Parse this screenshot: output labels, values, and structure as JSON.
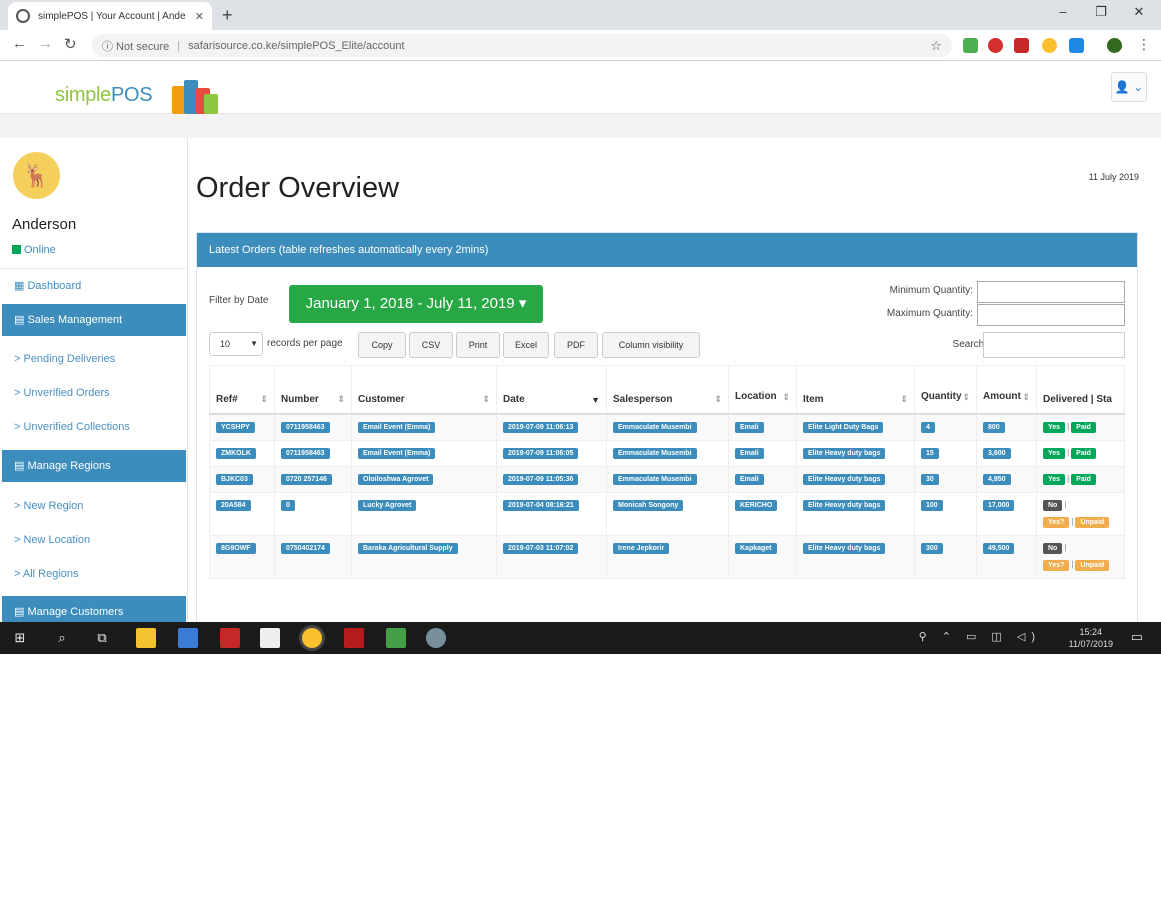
{
  "browser": {
    "tab_title": "simplePOS | Your Account | Ande",
    "tab_close": "✕",
    "new_tab": "+",
    "minimize": "–",
    "restore": "❐",
    "close": "✕",
    "back": "←",
    "forward": "→",
    "reload": "↻",
    "security": "ⓘ Not secure",
    "url": "safarisource.co.ke/simplePOS_Elite/account",
    "bookmark": "☆",
    "menu": "⋮"
  },
  "header": {
    "logo_simple": "simple",
    "logo_pos": "POS",
    "user_menu": "👤 ⌄"
  },
  "sidebar": {
    "avatar": "🦌",
    "user_name": "Anderson",
    "status": "Online",
    "dashboard": "▦ Dashboard",
    "sections": {
      "sales": "▤ Sales Management",
      "regions": "▤ Manage Regions",
      "customers": "▤ Manage Customers"
    },
    "sales_items": [
      "> Pending Deliveries",
      "> Unverified Orders",
      "> Unverified Collections"
    ],
    "region_items": [
      "> New Region",
      "> New Location",
      "> All Regions"
    ]
  },
  "main": {
    "title": "Order Overview",
    "date": "11 July 2019",
    "box_title": "Latest Orders (table refreshes automatically every 2mins)",
    "filter_label": "Filter by Date",
    "date_range": "January 1, 2018 - July 11, 2019 ▾",
    "min_qty_label": "Minimum Quantity:",
    "max_qty_label": "Maximum Quantity:",
    "page_size": "10",
    "per_page": "records per page",
    "buttons": [
      "Copy",
      "CSV",
      "Print",
      "Excel",
      "PDF",
      "Column visibility"
    ],
    "search_label": "Search:"
  },
  "table": {
    "columns": [
      "Ref#",
      "Number",
      "Customer",
      "Date",
      "Salesperson",
      "Location",
      "Item",
      "Quantity",
      "Amount",
      "Delivered | Sta"
    ],
    "rows": [
      {
        "ref": "YCSHPY",
        "number": "0711958463",
        "customer": "Email Event (Emma)",
        "date": "2019-07-09 11:06:13",
        "salesperson": "Emmaculate Musembi",
        "location": "Emali",
        "item": "Elite Light Duty Bags",
        "quantity": "4",
        "amount": "800",
        "delivered": "Yes",
        "status": "Paid"
      },
      {
        "ref": "ZMKOLK",
        "number": "0711958463",
        "customer": "Email Event (Emma)",
        "date": "2019-07-09 11:06:05",
        "salesperson": "Emmaculate Musembi",
        "location": "Emali",
        "item": "Elite Heavy duty bags",
        "quantity": "15",
        "amount": "3,600",
        "delivered": "Yes",
        "status": "Paid"
      },
      {
        "ref": "BJKC03",
        "number": "0720 257146",
        "customer": "Oloiloshwa Agrovet",
        "date": "2019-07-09 11:05:36",
        "salesperson": "Emmaculate Musembi",
        "location": "Emali",
        "item": "Elite Heavy duty bags",
        "quantity": "30",
        "amount": "4,950",
        "delivered": "Yes",
        "status": "Paid"
      },
      {
        "ref": "20A584",
        "number": "0",
        "customer": "Lucky Agrovet",
        "date": "2019-07-04 08:16:21",
        "salesperson": "Monicah Songony",
        "location": "KERICHO",
        "item": "Elite Heavy duty bags",
        "quantity": "100",
        "amount": "17,000",
        "delivered": "No",
        "status_1": "Yes?",
        "status_2": "Unpaid"
      },
      {
        "ref": "8G9OWF",
        "number": "0750402174",
        "customer": "Baraka Agricultural Supply",
        "date": "2019-07-03 11:07:02",
        "salesperson": "Irene Jepkorir",
        "location": "Kapkaget",
        "item": "Elite Heavy duty bags",
        "quantity": "300",
        "amount": "49,500",
        "delivered": "No",
        "status_1": "Yes?",
        "status_2": "Unpaid"
      }
    ]
  },
  "taskbar": {
    "start": "⊞",
    "search": "⌕",
    "task_view": "⧉",
    "tray_icons": "⚲ ⌃ ▭ ◫ ◁)",
    "time": "15:24",
    "date": "11/07/2019",
    "notifications": "▭"
  },
  "colors": {
    "primary": "#3c8dbc",
    "success": "#28a745",
    "label_green": "#00a65a",
    "warning": "#f0ad4e",
    "logo_green": "#8dc63f"
  }
}
